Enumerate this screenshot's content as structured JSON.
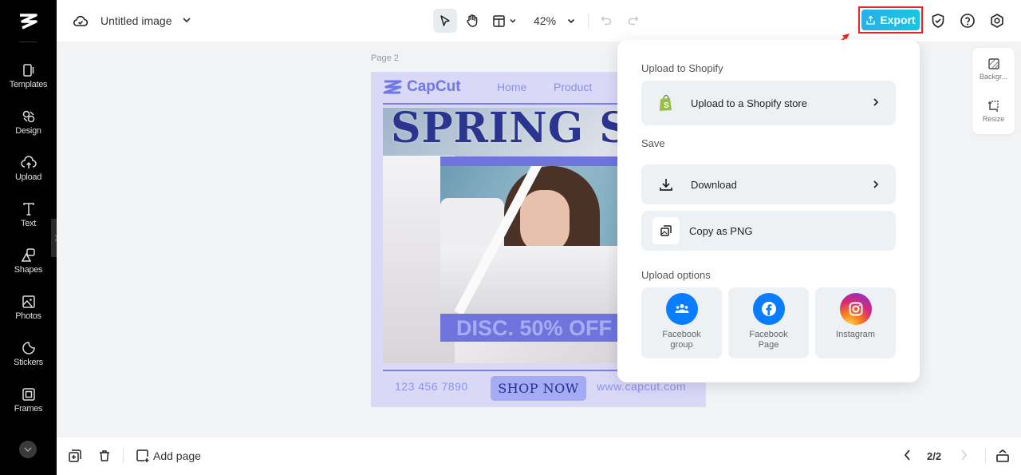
{
  "sidebar": {
    "items": [
      {
        "label": "Templates",
        "icon": "templates-icon"
      },
      {
        "label": "Design",
        "icon": "design-icon"
      },
      {
        "label": "Upload",
        "icon": "upload-cloud-icon"
      },
      {
        "label": "Text",
        "icon": "text-icon"
      },
      {
        "label": "Shapes",
        "icon": "shapes-icon"
      },
      {
        "label": "Photos",
        "icon": "photos-icon"
      },
      {
        "label": "Stickers",
        "icon": "stickers-icon"
      },
      {
        "label": "Frames",
        "icon": "frames-icon"
      }
    ]
  },
  "topbar": {
    "doc_title": "Untitled image",
    "zoom": "42%",
    "export_label": "Export"
  },
  "canvas": {
    "page_label": "Page 2",
    "poster": {
      "brand": "CapCut",
      "nav": [
        "Home",
        "Product"
      ],
      "headline": "SPRING SALE",
      "discount": "DISC. 50% OFF",
      "phone": "123 456 7890",
      "cta": "SHOP NOW",
      "website": "www.capcut.com"
    }
  },
  "right_panel": {
    "items": [
      {
        "label": "Backgr...",
        "icon": "background-icon"
      },
      {
        "label": "Resize",
        "icon": "resize-icon"
      }
    ]
  },
  "export_panel": {
    "sections": {
      "shopify": "Upload to Shopify",
      "save": "Save",
      "upload_options": "Upload options"
    },
    "shopify_row": "Upload to a Shopify store",
    "download_row": "Download",
    "copy_row": "Copy as PNG",
    "tiles": [
      {
        "label_line1": "Facebook",
        "label_line2": "group",
        "color": "#0a7cff"
      },
      {
        "label_line1": "Facebook",
        "label_line2": "Page",
        "color": "#0a7cff"
      },
      {
        "label_line1": "Instagram",
        "label_line2": "",
        "color": "#e1306c"
      }
    ]
  },
  "bottombar": {
    "add_page": "Add page",
    "page_indicator": "2/2"
  },
  "colors": {
    "export_gradient_start": "#28b0e8",
    "export_gradient_end": "#19c6df",
    "highlight_box": "#ee2222",
    "poster_bg": "#d9d8f7",
    "poster_accent": "#6e74dc"
  }
}
